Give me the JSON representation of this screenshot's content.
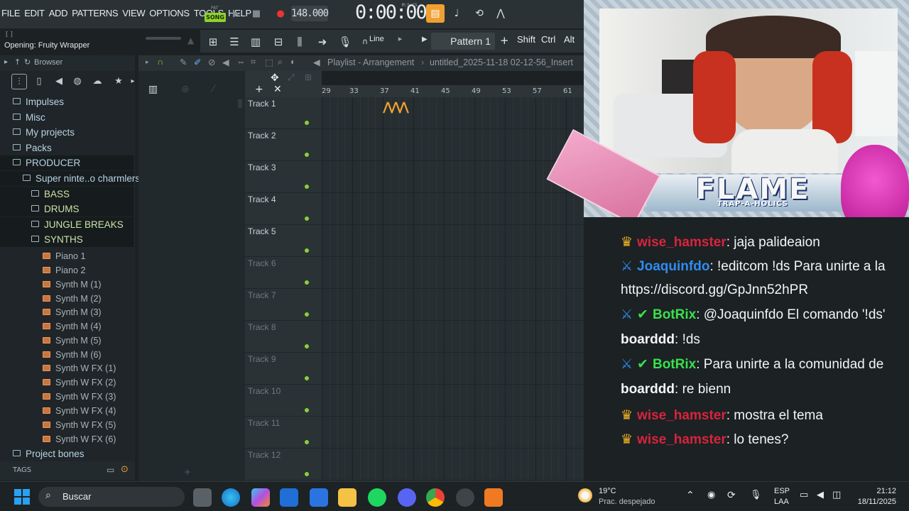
{
  "menu": [
    "FILE",
    "EDIT",
    "ADD",
    "PATTERNS",
    "VIEW",
    "OPTIONS",
    "TOOLS",
    "HELP"
  ],
  "transport": {
    "pat_label": "PAT",
    "song_label": "SONG",
    "tempo": "148.000",
    "time": "0:00:00",
    "time_unit": "M:S:CS"
  },
  "hint": {
    "line1": "[ ]",
    "line2": "Opening: Fruity Wrapper"
  },
  "toolbar2": {
    "snap": "Line",
    "pattern": "Pattern 1",
    "shift": "Shift",
    "ctrl": "Ctrl",
    "alt": "Alt"
  },
  "browser": {
    "title": "Browser",
    "items": [
      {
        "label": "Impulses",
        "type": "folder"
      },
      {
        "label": "Misc",
        "type": "folder"
      },
      {
        "label": "My projects",
        "type": "folder"
      },
      {
        "label": "Packs",
        "type": "folder"
      },
      {
        "label": "PRODUCER",
        "type": "folder"
      },
      {
        "label": "Super ninte..o charmlers",
        "type": "folder"
      },
      {
        "label": "BASS",
        "type": "folder"
      },
      {
        "label": "DRUMS",
        "type": "folder"
      },
      {
        "label": "JUNGLE BREAKS",
        "type": "folder"
      },
      {
        "label": "SYNTHS",
        "type": "folder"
      },
      {
        "label": "Piano 1",
        "type": "file"
      },
      {
        "label": "Piano 2",
        "type": "file"
      },
      {
        "label": "Synth M (1)",
        "type": "file"
      },
      {
        "label": "Synth M (2)",
        "type": "file"
      },
      {
        "label": "Synth M (3)",
        "type": "file"
      },
      {
        "label": "Synth M (4)",
        "type": "file"
      },
      {
        "label": "Synth M (5)",
        "type": "file"
      },
      {
        "label": "Synth M (6)",
        "type": "file"
      },
      {
        "label": "Synth W FX (1)",
        "type": "file"
      },
      {
        "label": "Synth W FX (2)",
        "type": "file"
      },
      {
        "label": "Synth W FX (3)",
        "type": "file"
      },
      {
        "label": "Synth W FX (4)",
        "type": "file"
      },
      {
        "label": "Synth W FX (5)",
        "type": "file"
      },
      {
        "label": "Synth W FX (6)",
        "type": "file"
      },
      {
        "label": "Project bones",
        "type": "folder"
      }
    ],
    "tags_label": "TAGS"
  },
  "playlist": {
    "title": "Playlist - Arrangement",
    "project": "untitled_2025-11-18 02-12-56_Insert",
    "ruler": [
      "29",
      "33",
      "37",
      "41",
      "45",
      "49",
      "53",
      "57",
      "61"
    ],
    "tracks": [
      "Track 1",
      "Track 2",
      "Track 3",
      "Track 4",
      "Track 5",
      "Track 6",
      "Track 7",
      "Track 8",
      "Track 9",
      "Track 10",
      "Track 11",
      "Track 12"
    ]
  },
  "stream": {
    "logo": "FLAME",
    "logo_sub": "TRAP-A-HOLICS",
    "chat": [
      {
        "user": "wise_hamster",
        "color": "red",
        "badge": "crown",
        "text": "jaja palideaion"
      },
      {
        "user": "Joaquinfdo",
        "color": "blue",
        "badge": "sword",
        "text": "!editcom !ds Para unirte a la"
      },
      {
        "user": "",
        "color": "",
        "badge": "",
        "text": "https://discord.gg/GpJnn52hPR"
      },
      {
        "user": "BotRix",
        "color": "green",
        "badge": "sword-check",
        "text": "@Joaquinfdo El comando '!ds'"
      },
      {
        "user": "boarddd",
        "color": "white",
        "badge": "",
        "text": "!ds"
      },
      {
        "user": "BotRix",
        "color": "green",
        "badge": "sword-check",
        "text": "Para unirte a la comunidad de"
      },
      {
        "user": "boarddd",
        "color": "white",
        "badge": "",
        "text": "re bienn"
      },
      {
        "user": "wise_hamster",
        "color": "red",
        "badge": "crown",
        "text": "mostra el tema"
      },
      {
        "user": "wise_hamster",
        "color": "red",
        "badge": "crown",
        "text": "lo tenes?"
      }
    ]
  },
  "taskbar": {
    "search": "Buscar",
    "weather_temp": "19°C",
    "weather_desc": "Prac. despejado",
    "lang1": "ESP",
    "lang2": "LAA",
    "time": "21:12",
    "date": "18/11/2025"
  },
  "colors": {
    "accent": "#8fd32a",
    "chat_red": "#d8243c",
    "chat_blue": "#2f8cf0",
    "chat_green": "#39e04b"
  }
}
